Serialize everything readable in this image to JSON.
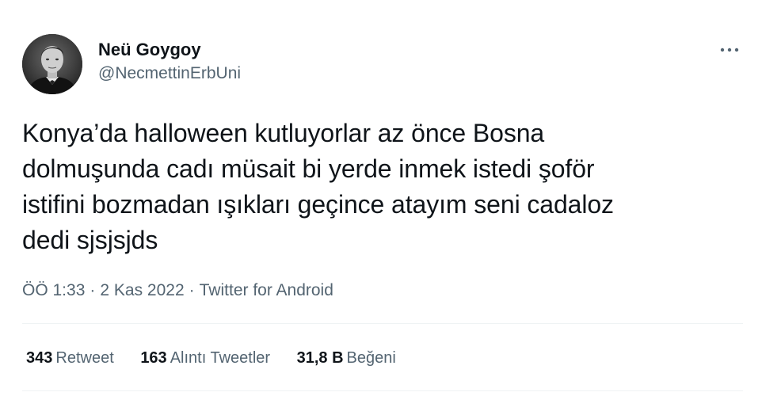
{
  "author": {
    "display_name": "Neü Goygoy",
    "handle": "@NecmettinErbUni",
    "avatar_icon": "avatar-portrait"
  },
  "more_icon": "more-horizontal-icon",
  "tweet": {
    "text": "Konya’da halloween kutluyorlar az önce Bosna\ndolmuşunda cadı müsait bi yerde inmek istedi şoför\nistifini bozmadan ışıkları geçince atayım seni cadaloz\ndedi sjsjsjds"
  },
  "meta": {
    "time": "ÖÖ 1:33",
    "date": "2 Kas 2022",
    "source": "Twitter for Android",
    "separator": "·"
  },
  "stats": {
    "retweets": {
      "count": "343",
      "label": "Retweet"
    },
    "quotes": {
      "count": "163",
      "label": "Alıntı Tweetler"
    },
    "likes": {
      "count": "31,8 B",
      "label": "Beğeni"
    }
  },
  "colors": {
    "text_primary": "#0f1419",
    "text_secondary": "#536471",
    "divider": "#eff3f4"
  }
}
